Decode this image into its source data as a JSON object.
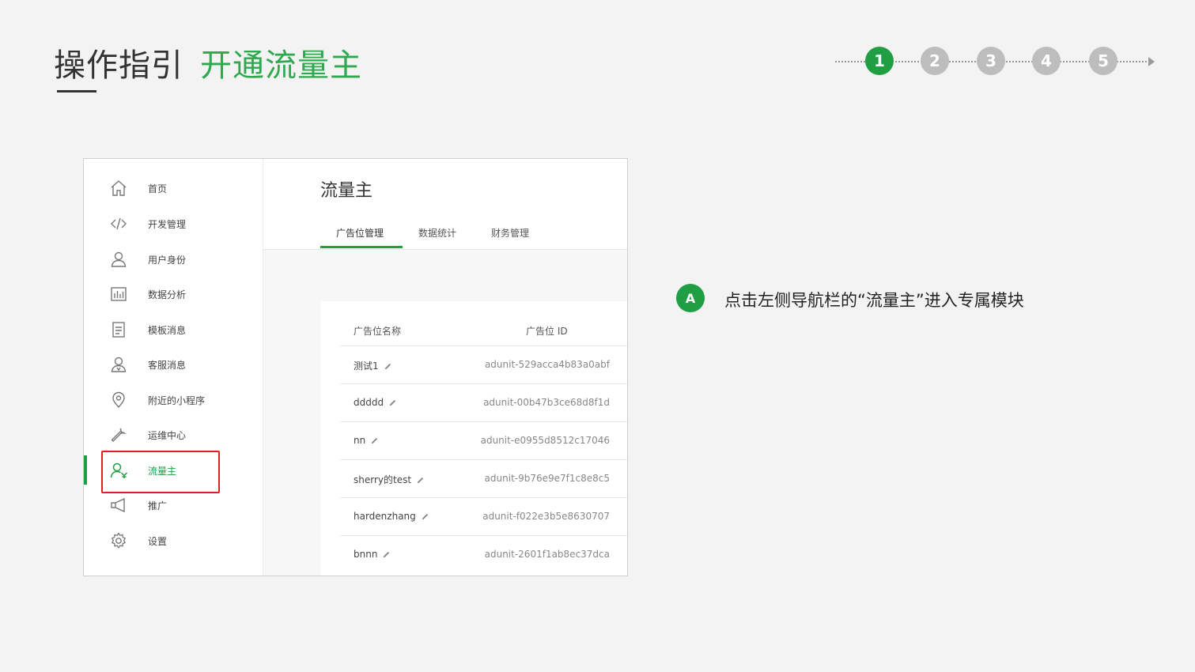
{
  "header": {
    "title_main": "操作指引",
    "title_sub": "开通流量主",
    "accent_color": "#1f9e44"
  },
  "steps": {
    "current": "1",
    "items": [
      "1",
      "2",
      "3",
      "4",
      "5"
    ]
  },
  "sidebar": {
    "items": [
      {
        "label": "首页",
        "icon": "home-icon"
      },
      {
        "label": "开发管理",
        "icon": "code-icon"
      },
      {
        "label": "用户身份",
        "icon": "user-icon"
      },
      {
        "label": "数据分析",
        "icon": "bar-chart-icon"
      },
      {
        "label": "模板消息",
        "icon": "document-icon"
      },
      {
        "label": "客服消息",
        "icon": "customer-service-icon"
      },
      {
        "label": "附近的小程序",
        "icon": "location-pin-icon"
      },
      {
        "label": "运维中心",
        "icon": "wrench-icon"
      },
      {
        "label": "流量主",
        "icon": "traffic-owner-icon",
        "active": true
      },
      {
        "label": "推广",
        "icon": "megaphone-icon"
      },
      {
        "label": "设置",
        "icon": "gear-icon"
      }
    ]
  },
  "main": {
    "page_title": "流量主",
    "tabs": [
      {
        "label": "广告位管理",
        "active": true
      },
      {
        "label": "数据统计"
      },
      {
        "label": "财务管理"
      }
    ],
    "table": {
      "columns": [
        "广告位名称",
        "广告位 ID"
      ],
      "rows": [
        {
          "name": "测试1",
          "id": "adunit-529acca4b83a0abf"
        },
        {
          "name": "ddddd",
          "id": "adunit-00b47b3ce68d8f1d"
        },
        {
          "name": "nn",
          "id": "adunit-e0955d8512c17046"
        },
        {
          "name": "sherry的test",
          "id": "adunit-9b76e9e7f1c8e8c5"
        },
        {
          "name": "hardenzhang",
          "id": "adunit-f022e3b5e8630707"
        },
        {
          "name": "bnnn",
          "id": "adunit-2601f1ab8ec37dca"
        }
      ]
    }
  },
  "annotation": {
    "badge": "A",
    "text": "点击左侧导航栏的“流量主”进入专属模块"
  }
}
